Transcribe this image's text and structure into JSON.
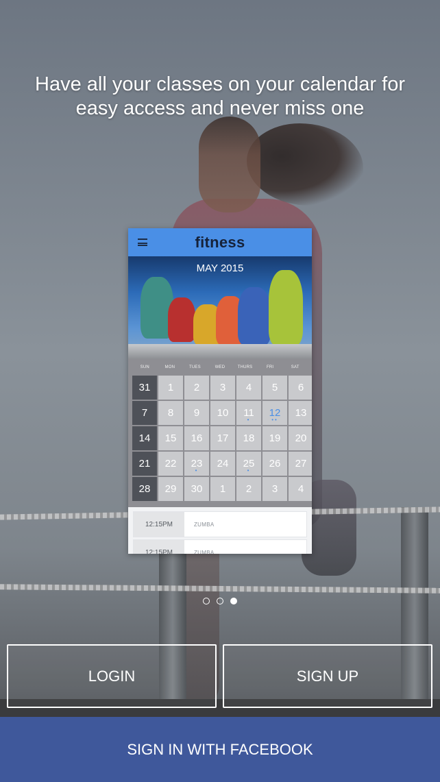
{
  "headline": "Have all your classes on your calendar for easy access and never miss one",
  "phone": {
    "app_title": "fitness",
    "month_label": "MAY 2015",
    "days_of_week": [
      "SUN",
      "MON",
      "TUES",
      "WED",
      "THURS",
      "FRI",
      "SAT"
    ],
    "weeks": [
      [
        "31",
        "1",
        "2",
        "3",
        "4",
        "5",
        "6"
      ],
      [
        "7",
        "8",
        "9",
        "10",
        "11",
        "12",
        "13"
      ],
      [
        "14",
        "15",
        "16",
        "17",
        "18",
        "19",
        "20"
      ],
      [
        "21",
        "22",
        "23",
        "24",
        "25",
        "26",
        "27"
      ],
      [
        "28",
        "29",
        "30",
        "1",
        "2",
        "3",
        "4"
      ]
    ],
    "schedule": [
      {
        "time": "12:15PM",
        "class": "ZUMBA"
      },
      {
        "time": "12:15PM",
        "class": "ZUMBA"
      }
    ]
  },
  "pager": {
    "count": 3,
    "active_index": 2
  },
  "buttons": {
    "login": "LOGIN",
    "signup": "SIGN UP",
    "facebook": "SIGN IN WITH FACEBOOK"
  },
  "colors": {
    "facebook_blue": "#3f589b",
    "app_header_blue": "#4a8fe6"
  }
}
